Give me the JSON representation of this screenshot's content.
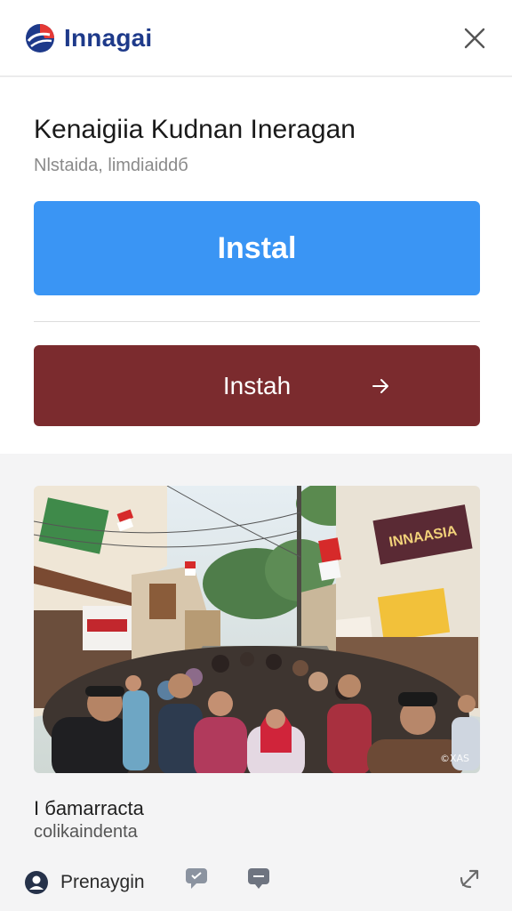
{
  "header": {
    "brand_name": "Innagai",
    "brand_color": "#1e3a8a"
  },
  "app": {
    "title": "Kenaigiia Kudnan Ineragan",
    "subtitle": "Nlstaida, limdiaiddб"
  },
  "actions": {
    "primary_label": "Instal",
    "primary_color": "#3a95f4",
    "secondary_label": "Instah",
    "secondary_color": "#7b2b2e"
  },
  "media": {
    "sign_left": "",
    "sign_right": "INNAASIA",
    "credit": "©XAS"
  },
  "caption": {
    "title": "I бamarracta",
    "subtitle": "сolikaindenta"
  },
  "footer": {
    "user_name": "Prenaygin"
  }
}
